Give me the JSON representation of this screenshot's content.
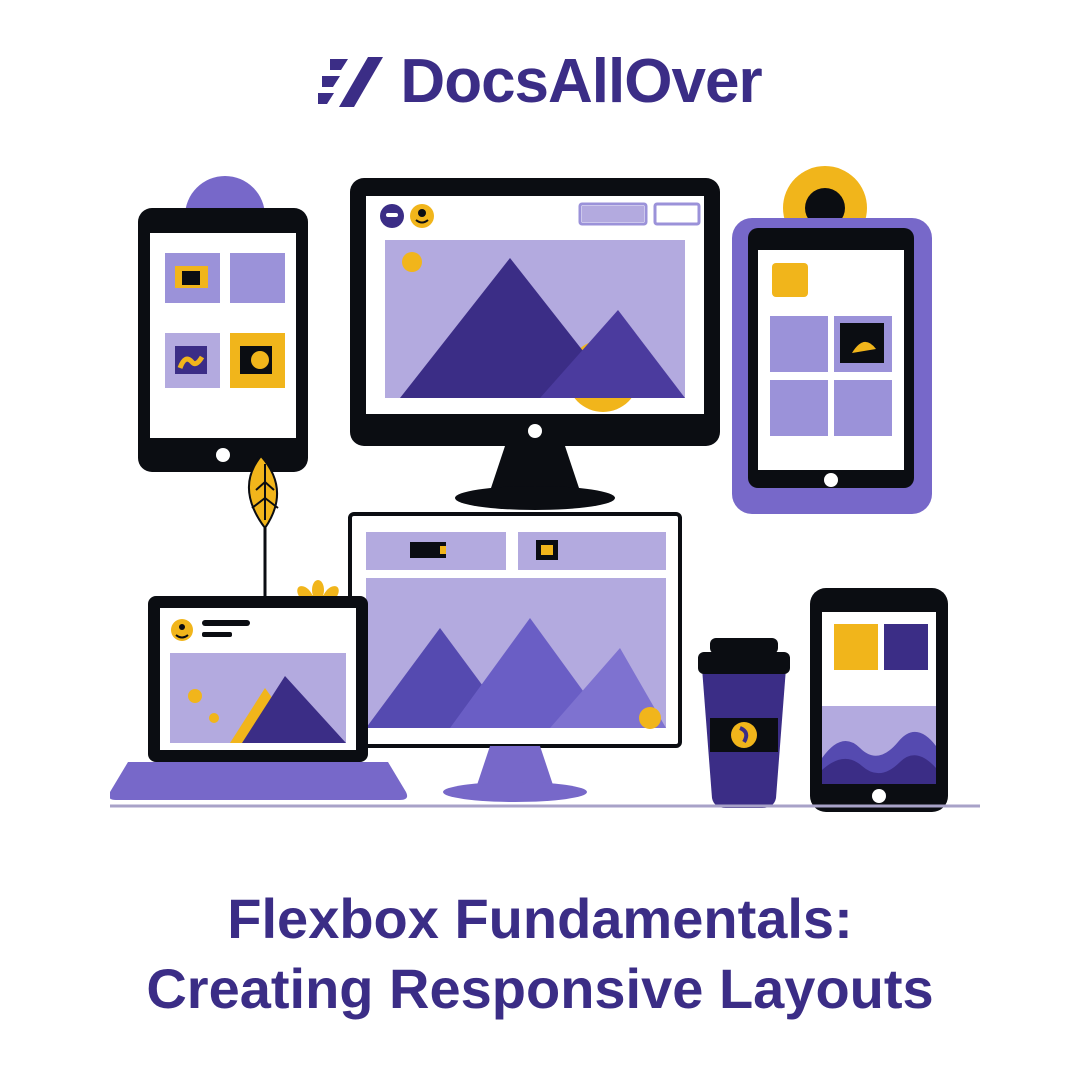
{
  "brand": {
    "name": "DocsAllOver"
  },
  "title_line1": "Flexbox Fundamentals:",
  "title_line2": "Creating Responsive Layouts",
  "colors": {
    "primary": "#3b2d86",
    "primary_light": "#9b92d9",
    "accent": "#f1b51b",
    "dark": "#0b0d12",
    "white": "#ffffff"
  },
  "illustration": {
    "devices": [
      "desktop-monitor",
      "tablet-left",
      "tablet-right",
      "laptop",
      "secondary-monitor",
      "coffee-cup",
      "smartphone"
    ]
  }
}
